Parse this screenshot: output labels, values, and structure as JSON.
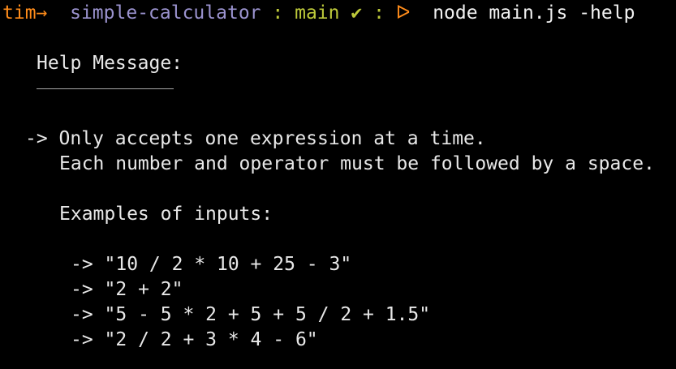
{
  "prompt": {
    "user": "tim",
    "arrow": "→",
    "directory": "simple-calculator",
    "separator1": ":",
    "branch": "main",
    "check": "✔",
    "separator2": ":",
    "triangle": "ᐅ",
    "command": "node main.js -help"
  },
  "help": {
    "title": "Help Message:",
    "rule_1": "-> Only accepts one expression at a time.",
    "rule_2": "Each number and operator must be followed by a space.",
    "examples_heading": "Examples of inputs:",
    "examples": [
      "-> \"10 / 2 * 10 + 25 - 3\"",
      "-> \"2 + 2\"",
      "-> \"5 - 5 * 2 + 5 + 5 / 2 + 1.5\"",
      "-> \"2 / 2 + 3 * 4 - 6\""
    ]
  }
}
